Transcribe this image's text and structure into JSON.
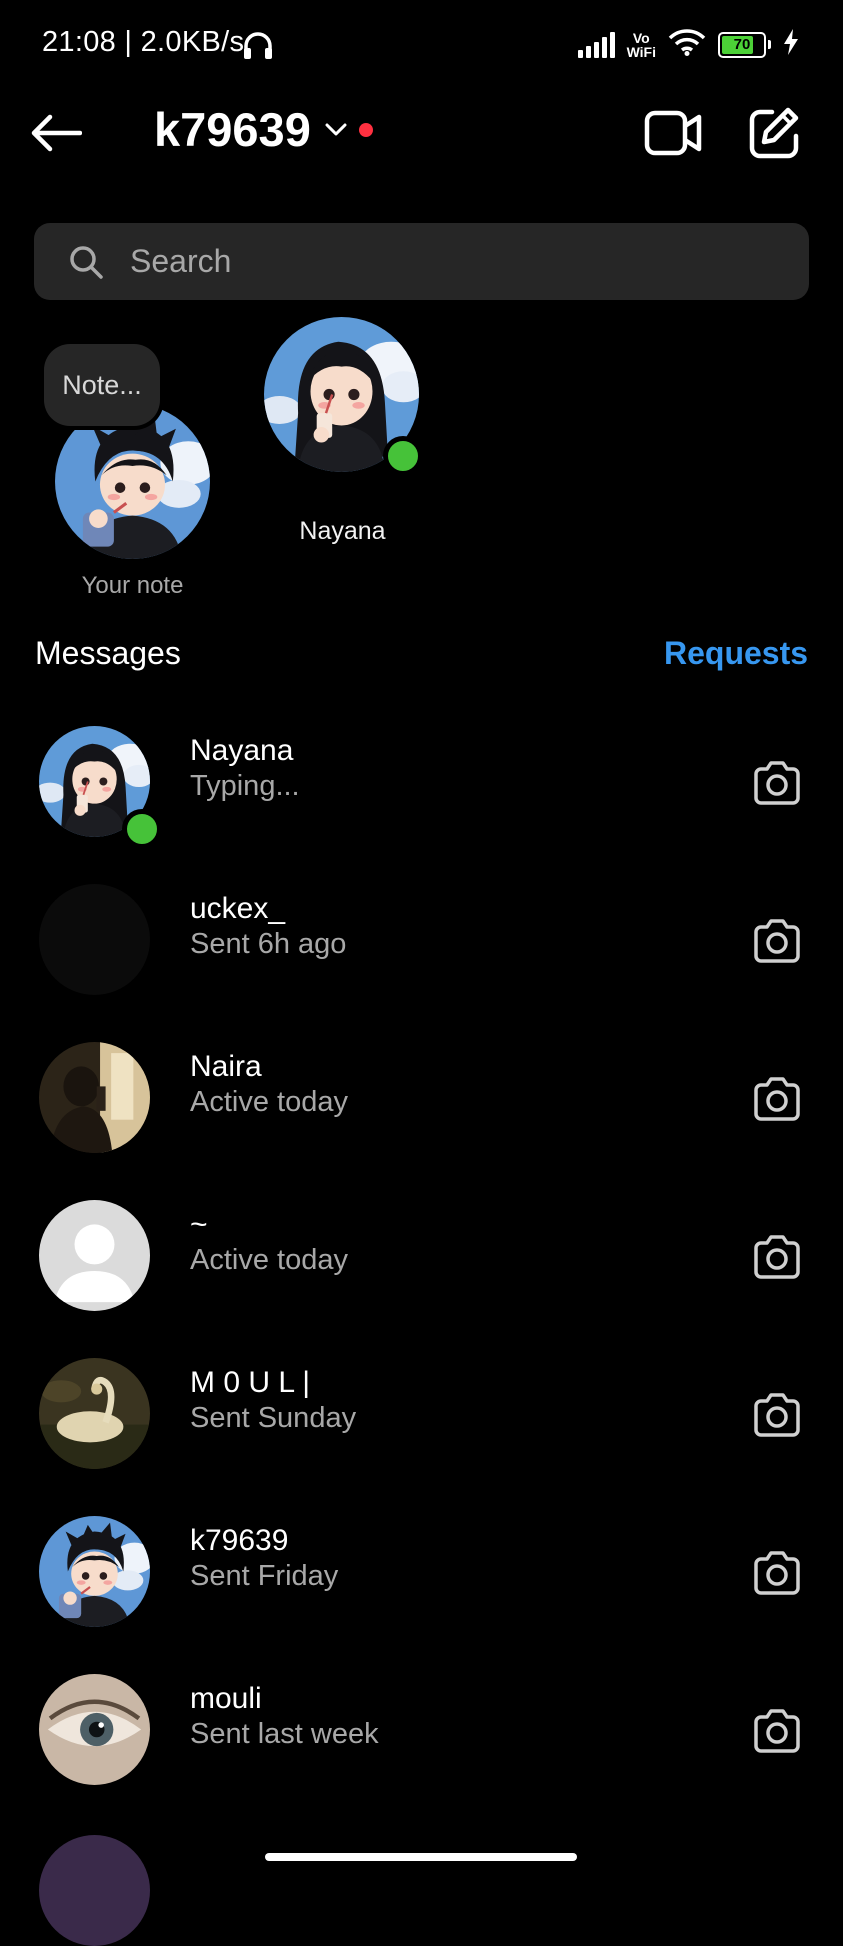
{
  "status_bar": {
    "time": "21:08 | 2.0KB/s",
    "vowifi_top": "Vo",
    "vowifi_bottom": "WiFi",
    "battery": "70"
  },
  "header": {
    "username": "k79639"
  },
  "search": {
    "placeholder": "Search"
  },
  "notes": {
    "note_bubble": "Note...",
    "your_note_label": "Your note",
    "story_name": "Nayana"
  },
  "messages": {
    "title": "Messages",
    "requests_label": "Requests",
    "threads": [
      {
        "name": "Nayana",
        "status": "Typing..."
      },
      {
        "name": "uckex_",
        "status": "Sent 6h ago"
      },
      {
        "name": "Naira",
        "status": "Active today"
      },
      {
        "name": "~",
        "status": "Active today"
      },
      {
        "name": "M 0 U L |",
        "status": "Sent Sunday"
      },
      {
        "name": "k79639",
        "status": "Sent Friday"
      },
      {
        "name": "mouli",
        "status": "Sent last week"
      }
    ]
  },
  "colors": {
    "background": "#000000",
    "search_bg": "#262626",
    "accent_blue": "#3797f0",
    "online_green": "#46c239",
    "unread_red": "#ff3040"
  }
}
